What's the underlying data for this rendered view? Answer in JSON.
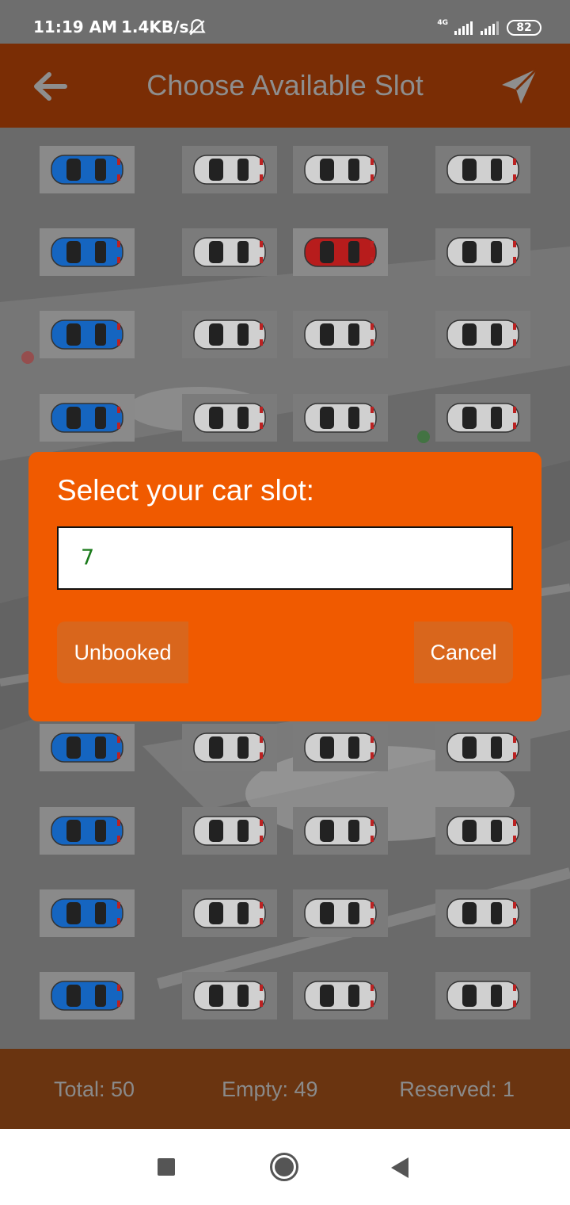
{
  "status_bar": {
    "time": "11:19 AM",
    "speed": "1.4KB/s",
    "network": "4G",
    "battery": "82"
  },
  "app_bar": {
    "title": "Choose Available Slot",
    "back_icon": "arrow-left-icon",
    "send_icon": "send-icon",
    "color": "#7a2d05"
  },
  "grid": {
    "columns": 4,
    "rows": [
      [
        "blue",
        "gray",
        "gray",
        "gray"
      ],
      [
        "blue",
        "gray",
        "red",
        "gray"
      ],
      [
        "blue",
        "gray",
        "gray",
        "gray"
      ],
      [
        "blue",
        "gray",
        "gray",
        "gray"
      ],
      [
        "blue",
        "gray",
        "gray",
        "gray"
      ],
      [
        "blue",
        "gray",
        "gray",
        "gray"
      ],
      [
        "blue",
        "gray",
        "gray",
        "gray"
      ],
      [
        "blue",
        "gray",
        "gray",
        "gray"
      ],
      [
        "blue",
        "gray",
        "gray",
        "gray"
      ],
      [
        "blue",
        "gray",
        "gray",
        "gray"
      ],
      [
        "blue",
        "gray",
        "gray",
        "gray"
      ]
    ],
    "car_colors": {
      "blue": "#1565c0",
      "gray": "#d0d0d0",
      "red": "#b71c1c"
    }
  },
  "dialog": {
    "title": "Select your car slot:",
    "input_value": "7",
    "unbooked_label": "Unbooked",
    "cancel_label": "Cancel",
    "color": "#f05a00"
  },
  "stats": {
    "total": "Total: 50",
    "empty": "Empty: 49",
    "reserved": "Reserved: 1"
  }
}
